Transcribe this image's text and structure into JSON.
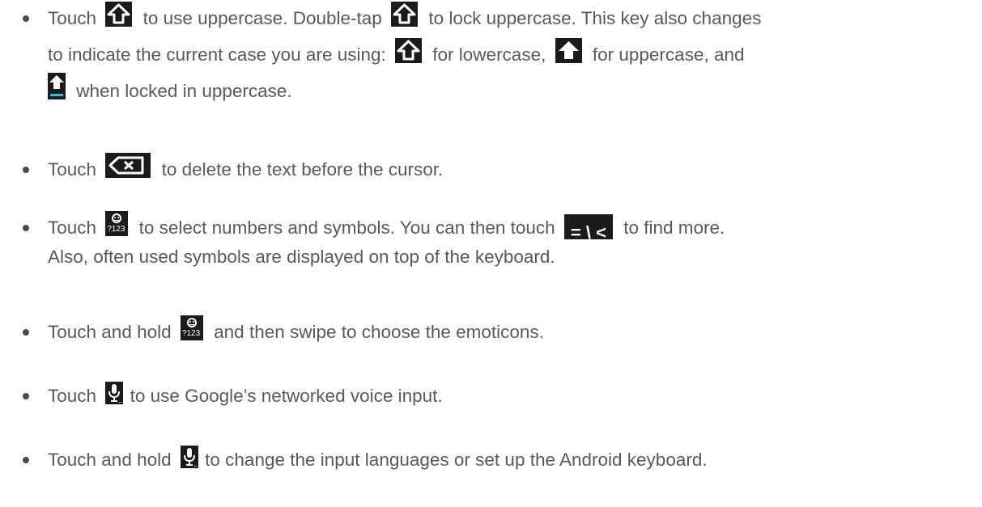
{
  "bullets": [
    {
      "seg": [
        "Touch",
        "to use uppercase. Double-tap",
        "to lock uppercase. This key also changes",
        "to indicate the current case you are using:",
        "for lowercase,",
        "for uppercase, and",
        "when locked in uppercase."
      ]
    },
    {
      "seg": [
        "Touch",
        "to delete the text before the cursor."
      ]
    },
    {
      "seg": [
        "Touch",
        "to select numbers and symbols. You can then touch",
        "to find more.",
        "Also, often used symbols are displayed on top of the keyboard."
      ]
    },
    {
      "seg": [
        "Touch and hold",
        "and then swipe to choose the emoticons."
      ]
    },
    {
      "seg": [
        "Touch",
        "to use Google’s networked voice input."
      ]
    },
    {
      "seg": [
        "Touch and hold",
        "to change the input languages or set up the Android keyboard."
      ]
    }
  ],
  "keys": {
    "symbols_key_label": "?123",
    "more_symbols_key_label": "= \\ <"
  }
}
